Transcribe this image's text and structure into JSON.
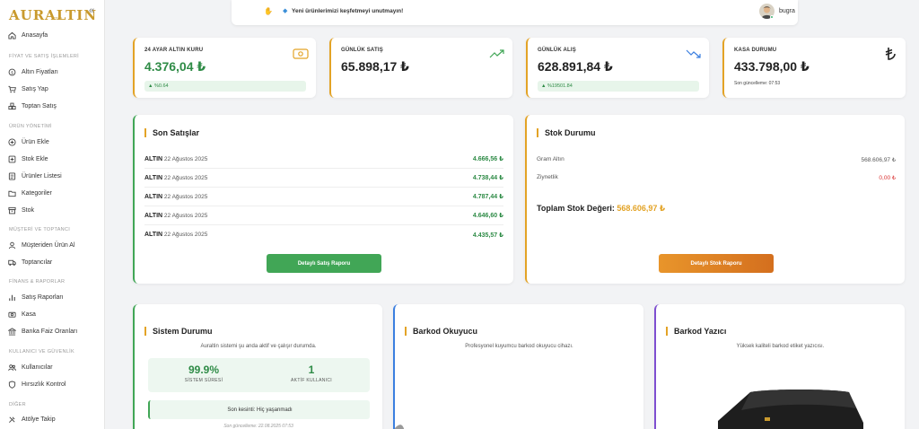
{
  "brand": {
    "name": "AURALTIN",
    "sub": ".com"
  },
  "sidebar": {
    "home": "Anasayfa",
    "sections": [
      {
        "title": "FİYAT VE SATIŞ İŞLEMLERİ",
        "items": [
          "Altın Fiyatları",
          "Satış Yap",
          "Toptan Satış"
        ]
      },
      {
        "title": "ÜRÜN YÖNETİMİ",
        "items": [
          "Ürün Ekle",
          "Stok Ekle",
          "Ürünler Listesi",
          "Kategoriler",
          "Stok"
        ]
      },
      {
        "title": "MÜŞTERİ VE TOPTANCI",
        "items": [
          "Müşteriden Ürün Al",
          "Toptancılar"
        ]
      },
      {
        "title": "FİNANS & RAPORLAR",
        "items": [
          "Satış Raporları",
          "Kasa",
          "Banka Faiz Oranları"
        ]
      },
      {
        "title": "KULLANICI VE GÜVENLİK",
        "items": [
          "Kullanıcılar",
          "Hırsızlık Kontrol"
        ]
      },
      {
        "title": "DİĞER",
        "items": [
          "Atölye Takip"
        ]
      }
    ]
  },
  "topbar": {
    "message": "Yeni ürünlerimizi keşfetmeyi unutmayın!",
    "user": "bugra"
  },
  "stats": [
    {
      "label": "24 AYAR ALTIN KURU",
      "value": "4.376,04 ₺",
      "badge": "▲ %0.64",
      "icon": "money-icon"
    },
    {
      "label": "GÜNLÜK SATIŞ",
      "value": "65.898,17 ₺",
      "icon": "trend-up-icon"
    },
    {
      "label": "GÜNLÜK ALIŞ",
      "value": "628.891,84 ₺",
      "badge": "▲ %19501.84",
      "icon": "trend-down-icon"
    },
    {
      "label": "KASA DURUMU",
      "value": "433.798,00 ₺",
      "note": "Son güncelleme: 07:53",
      "icon": "lira-icon"
    }
  ],
  "sales": {
    "title": "Son Satışlar",
    "rows": [
      {
        "product": "ALTIN",
        "date": "22 Ağustos 2025",
        "amount": "4.666,56 ₺"
      },
      {
        "product": "ALTIN",
        "date": "22 Ağustos 2025",
        "amount": "4.738,44 ₺"
      },
      {
        "product": "ALTIN",
        "date": "22 Ağustos 2025",
        "amount": "4.787,44 ₺"
      },
      {
        "product": "ALTIN",
        "date": "22 Ağustos 2025",
        "amount": "4.646,60 ₺"
      },
      {
        "product": "ALTIN",
        "date": "22 Ağustos 2025",
        "amount": "4.435,57 ₺"
      }
    ],
    "button": "Detaylı Satış Raporu"
  },
  "stock": {
    "title": "Stok Durumu",
    "rows": [
      {
        "label": "Gram Altın",
        "value": "568.606,97 ₺"
      },
      {
        "label": "Ziynetlik",
        "value": "0,00 ₺"
      }
    ],
    "total_label": "Toplam Stok Değeri:",
    "total_value": "568.606,97 ₺",
    "button": "Detaylı Stok Raporu",
    "colors": {
      "zero": "#d93030"
    }
  },
  "system": {
    "title": "Sistem Durumu",
    "subtitle": "Auraltin sistemi şu anda aktif ve çalışır durumda.",
    "uptime_value": "99.9%",
    "uptime_label": "SİSTEM SÜRESİ",
    "users_value": "1",
    "users_label": "AKTİF KULLANICI",
    "last_cut": "Son kesinti: Hiç yaşanmadı",
    "updated": "Son güncelleme: 22.08.2025 07:53"
  },
  "barcode_reader": {
    "title": "Barkod Okuyucu",
    "subtitle": "Profesyonel kuyumcu barkod okuyucu cihazı."
  },
  "barcode_printer": {
    "title": "Barkod Yazıcı",
    "subtitle": "Yüksek kaliteli barkod etiket yazıcısı."
  },
  "colors": {
    "accent": "#e3a326",
    "green": "#2e8b46",
    "blue": "#3b7fe0",
    "purple": "#7e4fd0"
  }
}
